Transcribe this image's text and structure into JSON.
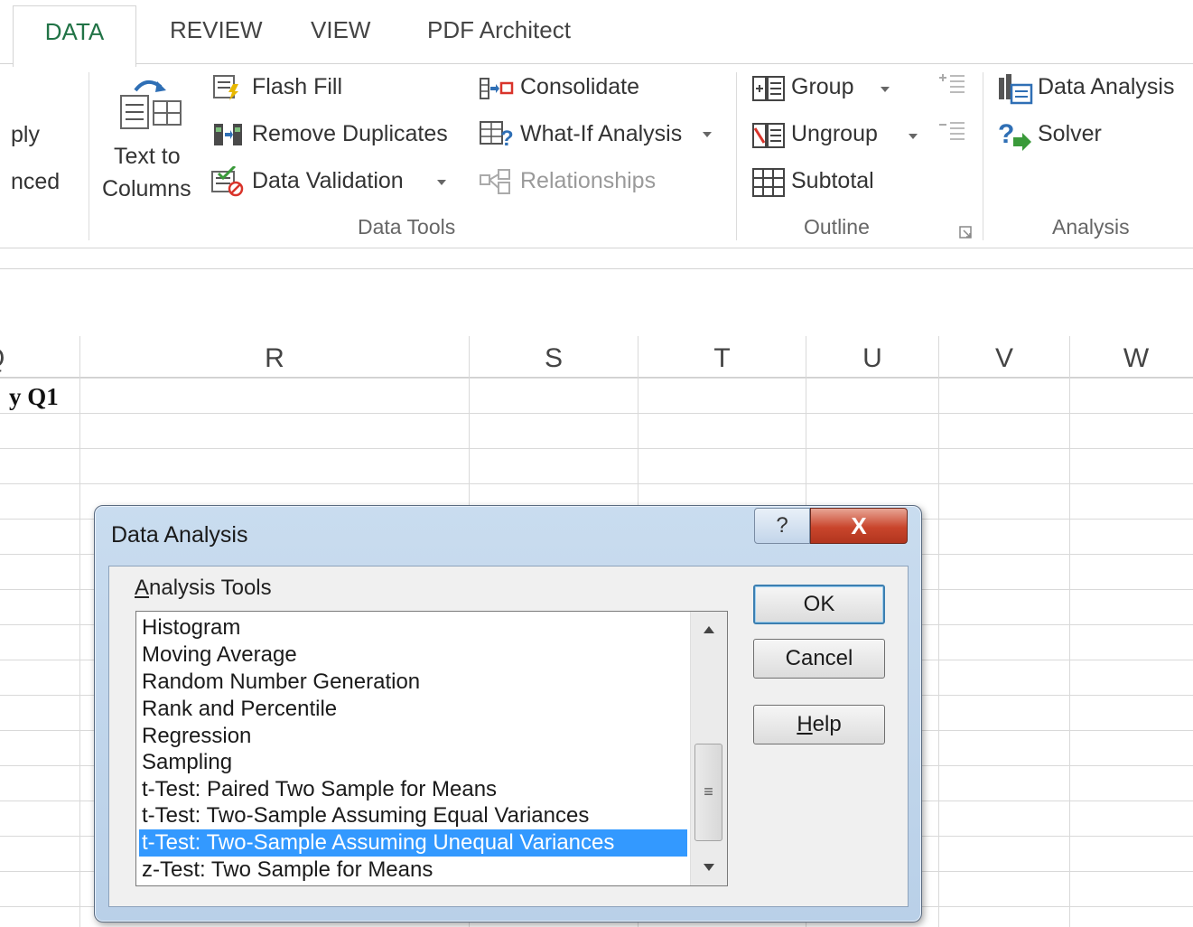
{
  "tabs": {
    "active": "DATA",
    "others": [
      "REVIEW",
      "VIEW",
      "PDF Architect"
    ]
  },
  "ribbon": {
    "left_partial": [
      "ply",
      "nced"
    ],
    "text_to_columns": [
      "Text to",
      "Columns"
    ],
    "data_tools": {
      "flash_fill": "Flash Fill",
      "remove_duplicates": "Remove Duplicates",
      "data_validation": "Data Validation",
      "consolidate": "Consolidate",
      "what_if": "What-If Analysis",
      "relationships": "Relationships",
      "group_label": "Data Tools"
    },
    "outline": {
      "group": "Group",
      "ungroup": "Ungroup",
      "subtotal": "Subtotal",
      "group_label": "Outline"
    },
    "analysis": {
      "data_analysis": "Data Analysis",
      "solver": "Solver",
      "group_label": "Analysis"
    }
  },
  "sheet": {
    "columns": [
      "Q",
      "R",
      "S",
      "T",
      "U",
      "V",
      "W"
    ],
    "partial_cell": "y Q1"
  },
  "dialog": {
    "title": "Data Analysis",
    "help_glyph": "?",
    "close_glyph": "X",
    "analysis_tools_label_first": "A",
    "analysis_tools_label_rest": "nalysis Tools",
    "items": [
      "Histogram",
      "Moving Average",
      "Random Number Generation",
      "Rank and Percentile",
      "Regression",
      "Sampling",
      "t-Test: Paired Two Sample for Means",
      "t-Test: Two-Sample Assuming Equal Variances",
      "t-Test: Two-Sample Assuming Unequal Variances",
      "z-Test: Two Sample for Means"
    ],
    "selected_item": "t-Test: Two-Sample Assuming Unequal Variances",
    "ok": "OK",
    "cancel": "Cancel",
    "help_first": "H",
    "help_rest": "elp"
  },
  "colors": {
    "accent": "#217346",
    "selection": "#3399ff",
    "close_button": "#c9452c"
  }
}
